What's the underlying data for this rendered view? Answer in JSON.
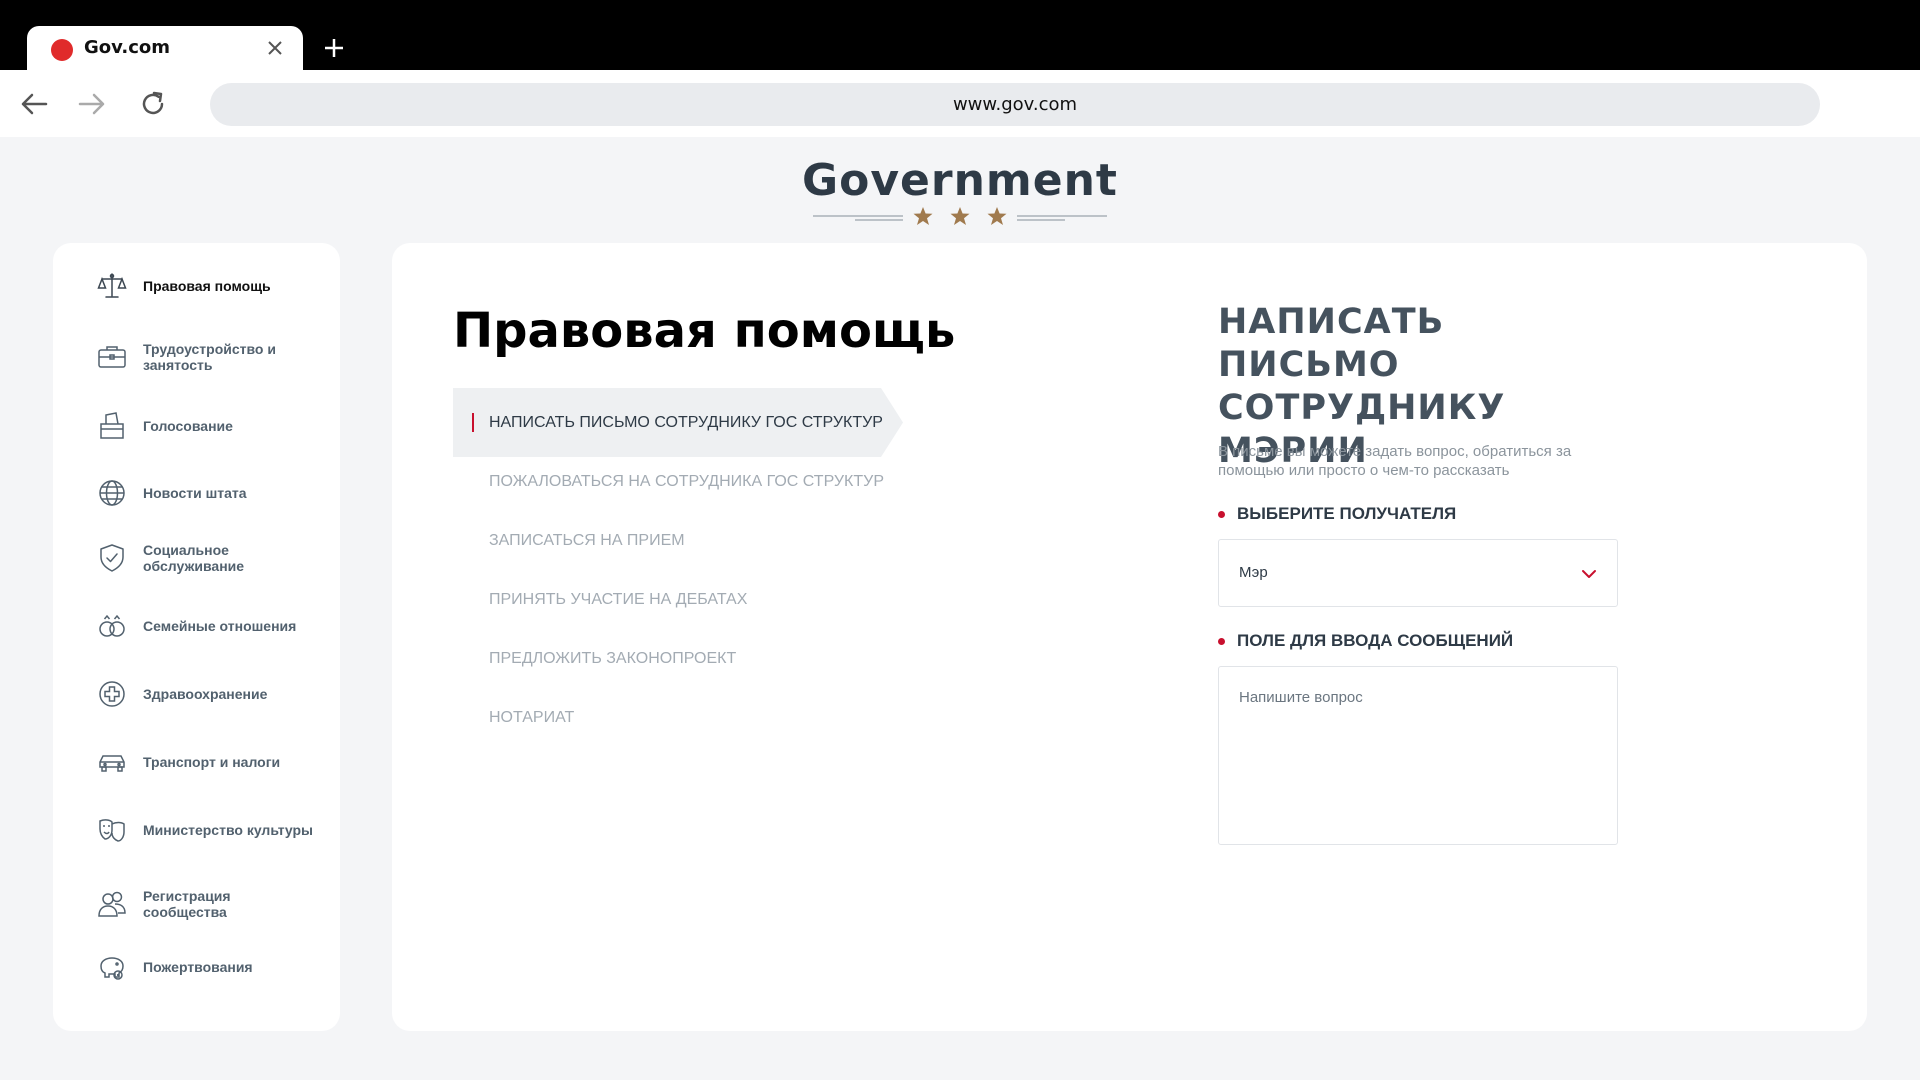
{
  "browser": {
    "tab_title": "Gov.com",
    "url": "www.gov.com"
  },
  "header": {
    "title": "Government"
  },
  "sidebar": {
    "items": [
      {
        "label": "Правовая помощь",
        "icon": "scales-icon",
        "active": true
      },
      {
        "label": "Трудоустройство и занятость",
        "icon": "briefcase-icon",
        "active": false
      },
      {
        "label": "Голосование",
        "icon": "ballot-box-icon",
        "active": false
      },
      {
        "label": "Новости штата",
        "icon": "globe-icon",
        "active": false
      },
      {
        "label": "Социальное обслуживание",
        "icon": "shield-check-icon",
        "active": false
      },
      {
        "label": "Семейные отношения",
        "icon": "rings-icon",
        "active": false
      },
      {
        "label": "Здравоохранение",
        "icon": "medical-cross-icon",
        "active": false
      },
      {
        "label": "Транспорт и налоги",
        "icon": "car-icon",
        "active": false
      },
      {
        "label": "Министерство культуры",
        "icon": "theater-masks-icon",
        "active": false
      },
      {
        "label": "Регистрация сообщества",
        "icon": "users-icon",
        "active": false
      },
      {
        "label": "Пожертвования",
        "icon": "piggy-bank-icon",
        "active": false
      }
    ]
  },
  "main": {
    "title": "Правовая помощь",
    "menu": [
      {
        "label": "НАПИСАТЬ ПИСЬМО СОТРУДНИКУ ГОС СТРУКТУР",
        "active": true
      },
      {
        "label": "ПОЖАЛОВАТЬСЯ НА СОТРУДНИКА ГОС СТРУКТУР",
        "active": false
      },
      {
        "label": "ЗАПИСАТЬСЯ НА ПРИЕМ",
        "active": false
      },
      {
        "label": "ПРИНЯТЬ УЧАСТИЕ НА ДЕБАТАХ",
        "active": false
      },
      {
        "label": "ПРЕДЛОЖИТЬ ЗАКОНОПРОЕКТ",
        "active": false
      },
      {
        "label": "НОТАРИАТ",
        "active": false
      }
    ],
    "form": {
      "title": "НАПИСАТЬ ПИСЬМО СОТРУДНИКУ МЭРИИ",
      "description": "В письме вы можете задать вопрос, обратиться за помощью или просто о чем-то рассказать",
      "recipient_label": "ВЫБЕРИТЕ ПОЛУЧАТЕЛЯ",
      "recipient_value": "Мэр",
      "message_label": "ПОЛЕ ДЛЯ ВВОДА СООБЩЕНИЙ",
      "message_placeholder": "Напишите вопрос"
    }
  },
  "colors": {
    "accent": "#c8102e",
    "ornament": "#a07a4e",
    "text_dark": "#2e3a46"
  }
}
